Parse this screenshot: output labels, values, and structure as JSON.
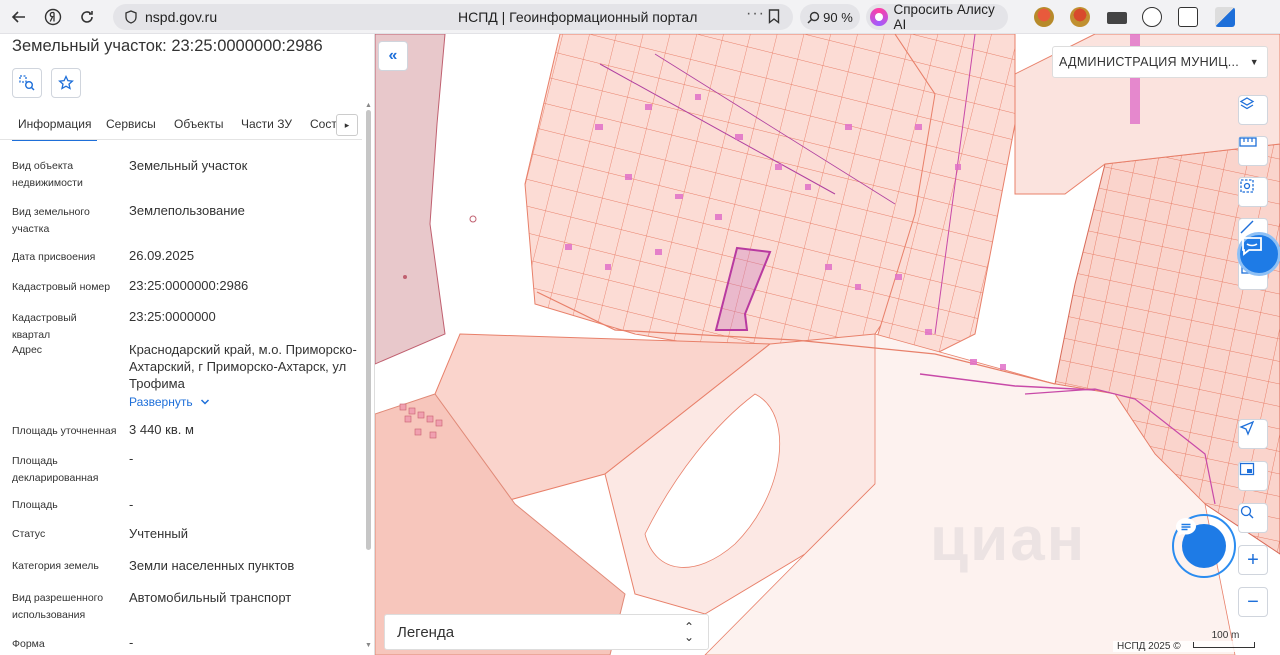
{
  "browser": {
    "url": "nspd.gov.ru",
    "tab_title": "НСПД | Геоинформационный портал",
    "zoom": "90 %",
    "alice_label": "Спросить Алису AI"
  },
  "panel": {
    "title": "Земельный участок: 23:25:0000000:2986",
    "tabs": [
      "Информация",
      "Сервисы",
      "Объекты",
      "Части ЗУ",
      "Состав"
    ],
    "rows": [
      {
        "label": "Вид объекта недвижимости",
        "value": "Земельный участок"
      },
      {
        "label": "Вид земельного участка",
        "value": "Землепользование"
      },
      {
        "label": "Дата присвоения",
        "value": "26.09.2025"
      },
      {
        "label": "Кадастровый номер",
        "value": "23:25:0000000:2986"
      },
      {
        "label": "Кадастровый квартал",
        "value": "23:25:0000000"
      },
      {
        "label": "Адрес",
        "value": "Краснодарский край, м.о. Приморско-Ахтарский, г Приморско-Ахтарск, ул Трофима"
      },
      {
        "label": "Площадь уточненная",
        "value": "3 440 кв. м"
      },
      {
        "label": "Площадь декларированная",
        "value": "-"
      },
      {
        "label": "Площадь",
        "value": "-"
      },
      {
        "label": "Статус",
        "value": "Учтенный"
      },
      {
        "label": "Категория земель",
        "value": "Земли населенных пунктов"
      },
      {
        "label": "Вид разрешенного использования",
        "value": "Автомобильный транспорт"
      },
      {
        "label": "Форма собственности",
        "value": "-"
      }
    ],
    "expand_label": "Развернуть"
  },
  "map": {
    "admin_select": "АДМИНИСТРАЦИЯ МУНИЦ...",
    "legend_label": "Легенда",
    "copyright": "НСПД 2025 ©",
    "scale_label": "100 m",
    "watermark": "циан",
    "colors": {
      "parcel_fill": "#fad4cc",
      "parcel_stroke": "#e8806a",
      "selected": "#b83aa0",
      "building": "#e070c8"
    }
  }
}
